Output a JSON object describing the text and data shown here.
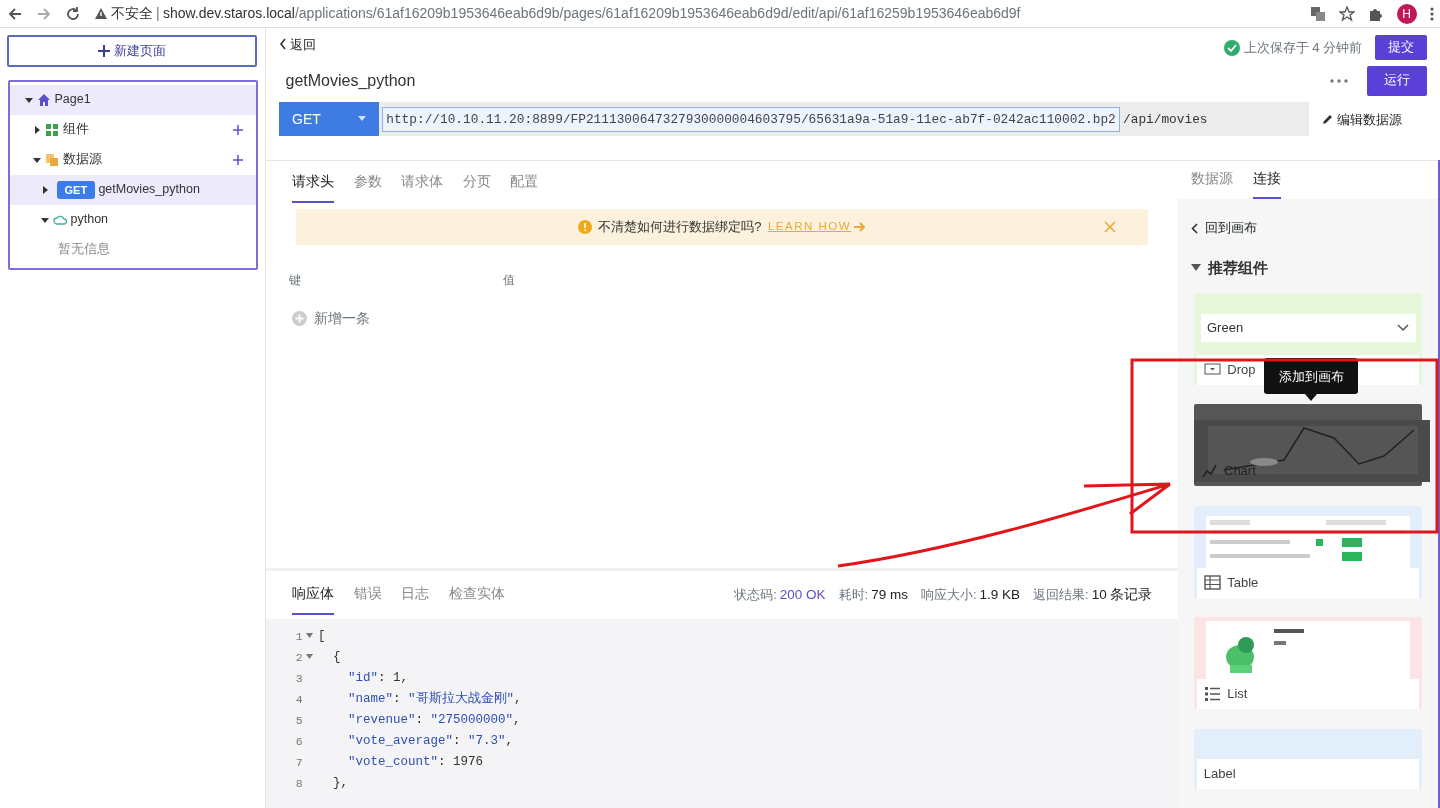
{
  "browser": {
    "security": "不安全",
    "separator": "|",
    "url_host": "show.dev.staros.local",
    "url_path": "/applications/61af16209b1953646eab6d9b/pages/61af16209b1953646eab6d9d/edit/api/61af16259b1953646eab6d9f",
    "avatar": "H"
  },
  "sidebar": {
    "new_page": "新建页面",
    "tree": [
      {
        "label": "Page1",
        "kind": "page",
        "expanded": true,
        "selected": true,
        "children": [
          {
            "label": "组件",
            "kind": "components",
            "expanded": false,
            "selected": false,
            "addable": true
          },
          {
            "label": "数据源",
            "kind": "datasources",
            "expanded": true,
            "selected": false,
            "addable": true,
            "children": [
              {
                "label": "getMovies_python",
                "kind": "query",
                "method": "GET",
                "expanded": false,
                "selected": true,
                "addable": false
              },
              {
                "label": "python",
                "kind": "source",
                "expanded": true,
                "selected": false,
                "addable": false,
                "children": [
                  {
                    "label": "暂无信息",
                    "kind": "empty"
                  }
                ]
              }
            ]
          }
        ]
      }
    ]
  },
  "header": {
    "back": "返回",
    "title": "getMovies_python",
    "saved": "上次保存于 4 分钟前",
    "submit": "提交",
    "run": "运行"
  },
  "request": {
    "method": "GET",
    "url": "http://10.10.11.20:8899/FP2111300647327930000004603795/65631a9a-51a9-11ec-ab7f-0242ac110002.bp2",
    "path": "/api/movies",
    "edit": "编辑数据源"
  },
  "request_tabs": [
    {
      "label": "请求头",
      "selected": true
    },
    {
      "label": "参数",
      "selected": false
    },
    {
      "label": "请求体",
      "selected": false
    },
    {
      "label": "分页",
      "selected": false
    },
    {
      "label": "配置",
      "selected": false
    }
  ],
  "alert": {
    "text": "不清楚如何进行数据绑定吗?",
    "link": "LEARN HOW"
  },
  "headers_table": {
    "columns": [
      "键",
      "值"
    ],
    "add": "新增一条"
  },
  "response_tabs": [
    {
      "label": "响应体",
      "selected": true
    },
    {
      "label": "错误",
      "selected": false
    },
    {
      "label": "日志",
      "selected": false
    },
    {
      "label": "检查实体",
      "selected": false
    }
  ],
  "stats": [
    {
      "label": "状态码:",
      "value": "200 OK",
      "kind": "status"
    },
    {
      "label": "耗时:",
      "value": "79 ms",
      "kind": "plain"
    },
    {
      "label": "响应大小:",
      "value": "1.9 KB",
      "kind": "plain"
    },
    {
      "label": "返回结果:",
      "value": "10 条记录",
      "kind": "plain"
    }
  ],
  "code_lines": [
    {
      "number": "1",
      "fold": true,
      "tokens": [
        {
          "t": "[",
          "kind": "punct"
        }
      ]
    },
    {
      "number": "2",
      "fold": true,
      "tokens": [
        {
          "t": "  {",
          "kind": "punct"
        }
      ]
    },
    {
      "number": "3",
      "fold": false,
      "tokens": [
        {
          "t": "    \"id\"",
          "kind": "key"
        },
        {
          "t": ": ",
          "kind": "punct"
        },
        {
          "t": "1",
          "kind": "number"
        },
        {
          "t": ",",
          "kind": "punct"
        }
      ]
    },
    {
      "number": "4",
      "fold": false,
      "tokens": [
        {
          "t": "    \"name\"",
          "kind": "key"
        },
        {
          "t": ": ",
          "kind": "punct"
        },
        {
          "t": "\"哥斯拉大战金刚\"",
          "kind": "string"
        },
        {
          "t": ",",
          "kind": "punct"
        }
      ]
    },
    {
      "number": "5",
      "fold": false,
      "tokens": [
        {
          "t": "    \"revenue\"",
          "kind": "key"
        },
        {
          "t": ": ",
          "kind": "punct"
        },
        {
          "t": "\"275000000\"",
          "kind": "string"
        },
        {
          "t": ",",
          "kind": "punct"
        }
      ]
    },
    {
      "number": "6",
      "fold": false,
      "tokens": [
        {
          "t": "    \"vote_average\"",
          "kind": "key"
        },
        {
          "t": ": ",
          "kind": "punct"
        },
        {
          "t": "\"7.3\"",
          "kind": "string"
        },
        {
          "t": ",",
          "kind": "punct"
        }
      ]
    },
    {
      "number": "7",
      "fold": false,
      "tokens": [
        {
          "t": "    \"vote_count\"",
          "kind": "key"
        },
        {
          "t": ": ",
          "kind": "punct"
        },
        {
          "t": "1976",
          "kind": "number"
        }
      ]
    },
    {
      "number": "8",
      "fold": false,
      "tokens": [
        {
          "t": "  },",
          "kind": "punct"
        }
      ]
    }
  ],
  "right_panel": {
    "tabs": [
      {
        "label": "数据源",
        "selected": false
      },
      {
        "label": "连接",
        "selected": true
      }
    ],
    "back": "回到画布",
    "section": {
      "title": "推荐组件",
      "expanded": true
    },
    "tooltip": "添加到画布",
    "cards": [
      {
        "kind": "dropdown",
        "label": "Drop",
        "preview_value": "Green",
        "color": "#e6f7dc",
        "hovered": false
      },
      {
        "kind": "chart",
        "label": "Chart",
        "hovered": true
      },
      {
        "kind": "table",
        "label": "Table",
        "color": "#e3eefb",
        "hovered": false
      },
      {
        "kind": "list",
        "label": "List",
        "color": "#fbe3e6",
        "hovered": false
      },
      {
        "kind": "label",
        "label": "Label",
        "color": "#e3eefb",
        "hovered": false
      }
    ]
  }
}
